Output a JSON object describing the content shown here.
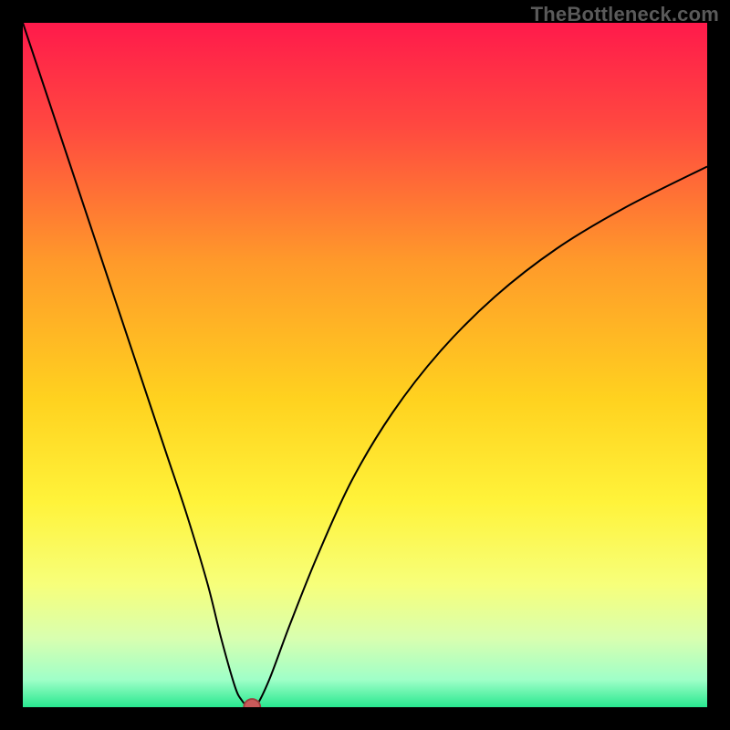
{
  "watermark": "TheBottleneck.com",
  "colors": {
    "frame": "#000000",
    "curve": "#000000",
    "dot_fill": "#c85a5a",
    "dot_stroke": "#9e3f3f"
  },
  "chart_data": {
    "type": "line",
    "title": "",
    "xlabel": "",
    "ylabel": "",
    "xlim": [
      0,
      100
    ],
    "ylim": [
      0,
      100
    ],
    "grid": false,
    "legend": false,
    "background_gradient_stops": [
      {
        "pct": 0,
        "color": "#ff1a4b"
      },
      {
        "pct": 15,
        "color": "#ff4840"
      },
      {
        "pct": 35,
        "color": "#ff9a2a"
      },
      {
        "pct": 55,
        "color": "#ffd21f"
      },
      {
        "pct": 70,
        "color": "#fff33a"
      },
      {
        "pct": 82,
        "color": "#f7ff7a"
      },
      {
        "pct": 90,
        "color": "#d8ffb0"
      },
      {
        "pct": 96,
        "color": "#9fffc8"
      },
      {
        "pct": 100,
        "color": "#28e88f"
      }
    ],
    "series": [
      {
        "name": "bottleneck-curve",
        "note": "y ≈ 100 at x=0, drops to 0 near x≈33, rises asymptotically toward ~80 at x=100; slight flat bottom around minimum",
        "x": [
          0,
          3,
          6,
          9,
          12,
          15,
          18,
          21,
          24,
          27,
          29,
          31,
          32,
          33,
          34,
          36,
          39,
          43,
          48,
          54,
          61,
          69,
          78,
          88,
          100
        ],
        "y": [
          100,
          91,
          82,
          73,
          64,
          55,
          46,
          37,
          28,
          18,
          10,
          3,
          1,
          0,
          0,
          4,
          12,
          22,
          33,
          43,
          52,
          60,
          67,
          73,
          79
        ]
      }
    ],
    "marker": {
      "x": 33.5,
      "y": 0,
      "r": 1.2
    }
  }
}
